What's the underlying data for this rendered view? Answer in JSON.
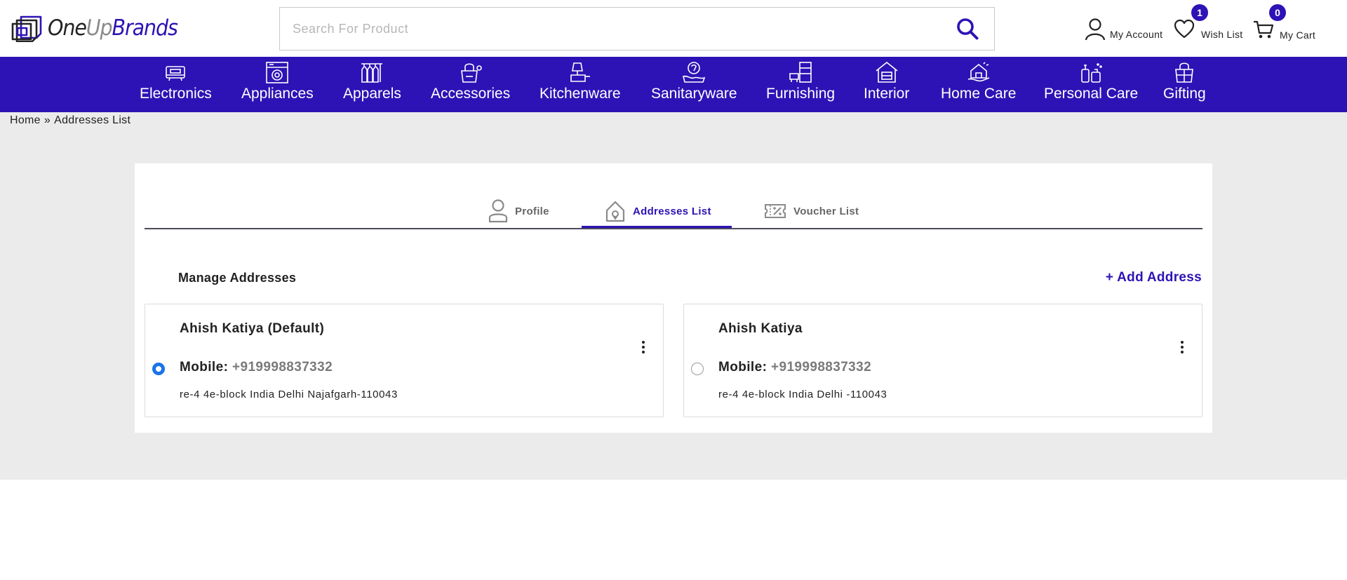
{
  "header": {
    "logo": {
      "part1": "One",
      "part2": "Up",
      "part3": "Brands"
    },
    "search": {
      "placeholder": "Search For Product",
      "value": ""
    },
    "account_label": "My Account",
    "wishlist_label": "Wish List",
    "wishlist_count": "1",
    "cart_label": "My Cart",
    "cart_count": "0"
  },
  "nav": {
    "items": [
      {
        "label": "Electronics"
      },
      {
        "label": "Appliances"
      },
      {
        "label": "Apparels"
      },
      {
        "label": "Accessories"
      },
      {
        "label": "Kitchenware"
      },
      {
        "label": "Sanitaryware"
      },
      {
        "label": "Furnishing"
      },
      {
        "label": "Interior"
      },
      {
        "label": "Home Care"
      },
      {
        "label": "Personal Care"
      },
      {
        "label": "Gifting"
      }
    ]
  },
  "breadcrumb": {
    "home": "Home",
    "separator": "»",
    "current": "Addresses List"
  },
  "tabs": [
    {
      "label": "Profile",
      "active": false
    },
    {
      "label": "Addresses List",
      "active": true
    },
    {
      "label": "Voucher List",
      "active": false
    }
  ],
  "section": {
    "title": "Manage Addresses",
    "add_label": "+ Add Address"
  },
  "addresses": [
    {
      "name": "Ahish Katiya (Default)",
      "mobile_label": "Mobile:",
      "mobile": "+919998837332",
      "line": "re-4 4e-block India Delhi Najafgarh-110043",
      "selected": true
    },
    {
      "name": "Ahish Katiya",
      "mobile_label": "Mobile:",
      "mobile": "+919998837332",
      "line": "re-4 4e-block India Delhi -110043",
      "selected": false
    }
  ],
  "colors": {
    "brand": "#2d13b5",
    "radio": "#1a73e8",
    "page_grey": "#ebebeb"
  }
}
